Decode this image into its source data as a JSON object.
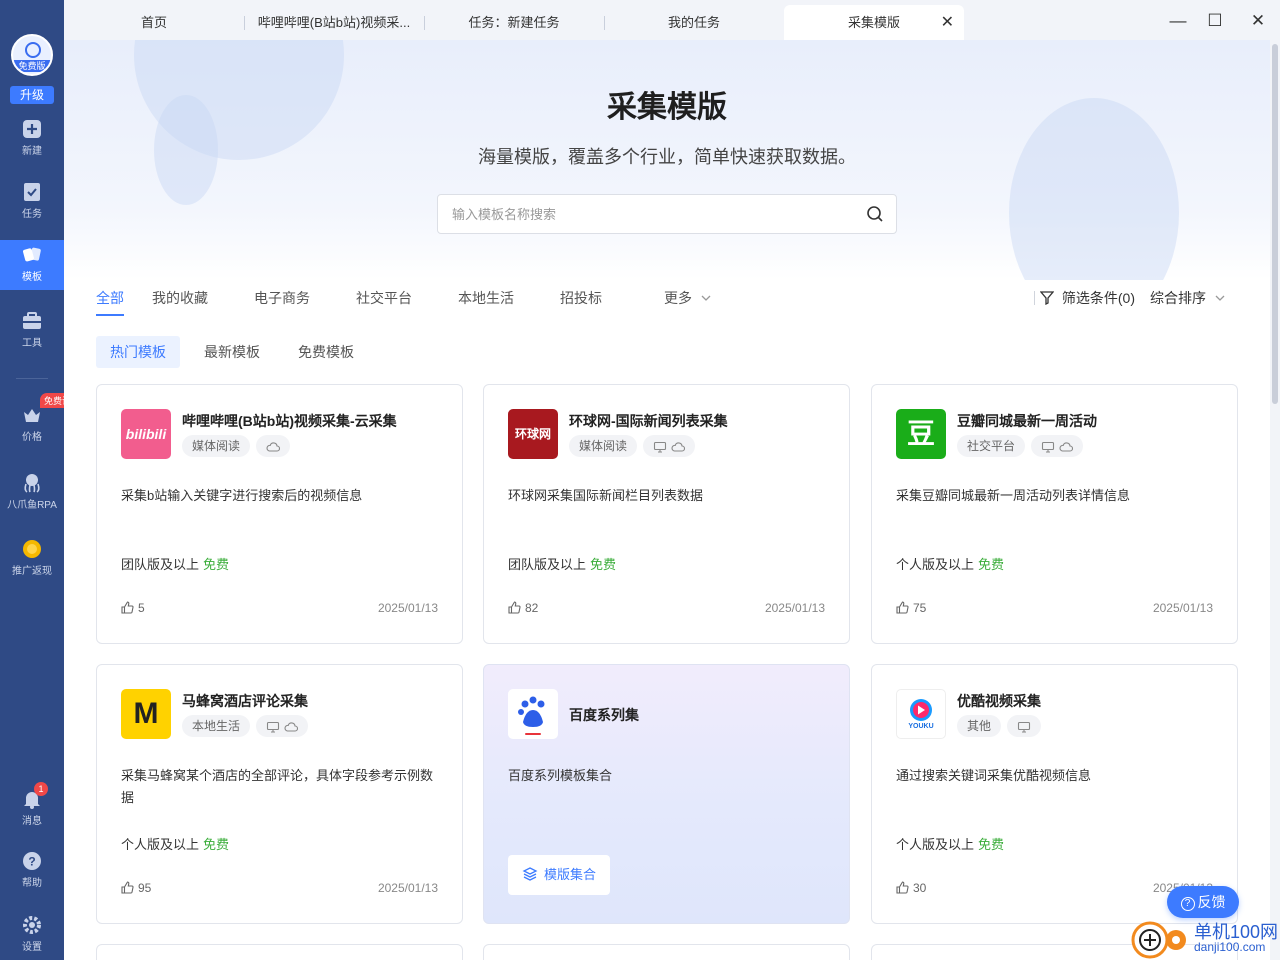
{
  "sidebar": {
    "avatar_badge": "免费版",
    "upgrade": "升级",
    "items": [
      {
        "label": "新建",
        "icon": "plus-square-icon"
      },
      {
        "label": "任务",
        "icon": "task-icon"
      },
      {
        "label": "模板",
        "icon": "template-icon"
      },
      {
        "label": "工具",
        "icon": "toolbox-icon"
      },
      {
        "label": "价格",
        "icon": "crown-icon"
      },
      {
        "label": "八爪鱼RPA",
        "icon": "octopus-icon"
      },
      {
        "label": "推广返现",
        "icon": "coin-icon"
      },
      {
        "label": "消息",
        "icon": "bell-icon"
      },
      {
        "label": "帮助",
        "icon": "help-icon"
      },
      {
        "label": "设置",
        "icon": "gear-icon"
      }
    ],
    "trial_badge": "免费试用",
    "message_count": "1"
  },
  "tabs": [
    {
      "label": "首页"
    },
    {
      "label": "哔哩哔哩(B站b站)视频采..."
    },
    {
      "label": "任务：新建任务"
    },
    {
      "label": "我的任务"
    },
    {
      "label": "采集模版"
    }
  ],
  "window_controls": {
    "minimize": "—",
    "maximize": "☐",
    "close": "✕"
  },
  "hero": {
    "title": "采集模版",
    "subtitle": "海量模版，覆盖多个行业，简单快速获取数据。",
    "search_placeholder": "输入模板名称搜索"
  },
  "categories": [
    "全部",
    "我的收藏",
    "电子商务",
    "社交平台",
    "本地生活",
    "招投标",
    "更多"
  ],
  "filter_label": "筛选条件(0)",
  "sort_label": "综合排序",
  "subtabs": [
    "热门模板",
    "最新模板",
    "免费模板"
  ],
  "cards": [
    {
      "title": "哔哩哔哩(B站b站)视频采集-云采集",
      "tag": "媒体阅读",
      "desc": "采集b站输入关键字进行搜索后的视频信息",
      "plan": "团队版及以上",
      "free": "免费",
      "likes": "5",
      "date": "2025/01/13",
      "logo_text": "bilibili"
    },
    {
      "title": "环球网-国际新闻列表采集",
      "tag": "媒体阅读",
      "desc": "环球网采集国际新闻栏目列表数据",
      "plan": "团队版及以上",
      "free": "免费",
      "likes": "82",
      "date": "2025/01/13",
      "logo_text": "环球网"
    },
    {
      "title": "豆瓣同城最新一周活动",
      "tag": "社交平台",
      "desc": "采集豆瓣同城最新一周活动列表详情信息",
      "plan": "个人版及以上",
      "free": "免费",
      "likes": "75",
      "date": "2025/01/13",
      "logo_text": "豆"
    },
    {
      "title": "马蜂窝酒店评论采集",
      "tag": "本地生活",
      "desc": "采集马蜂窝某个酒店的全部评论，具体字段参考示例数据",
      "plan": "个人版及以上",
      "free": "免费",
      "likes": "95",
      "date": "2025/01/13",
      "logo_text": "M"
    },
    {
      "title": "百度系列集",
      "desc": "百度系列模板集合",
      "button": "模版集合",
      "logo_text": "du"
    },
    {
      "title": "优酷视频采集",
      "tag": "其他",
      "desc": "通过搜索关键词采集优酷视频信息",
      "plan": "个人版及以上",
      "free": "免费",
      "likes": "30",
      "date": "2025/01/13",
      "logo_text": "YOUKU"
    }
  ],
  "feedback": "反馈",
  "watermark": {
    "text": "单机100网",
    "url": "danji100.com"
  },
  "colors": {
    "sidebar": "#2f4a85",
    "accent": "#3d7bff",
    "free": "#3aad3a",
    "badge": "#f04848"
  }
}
